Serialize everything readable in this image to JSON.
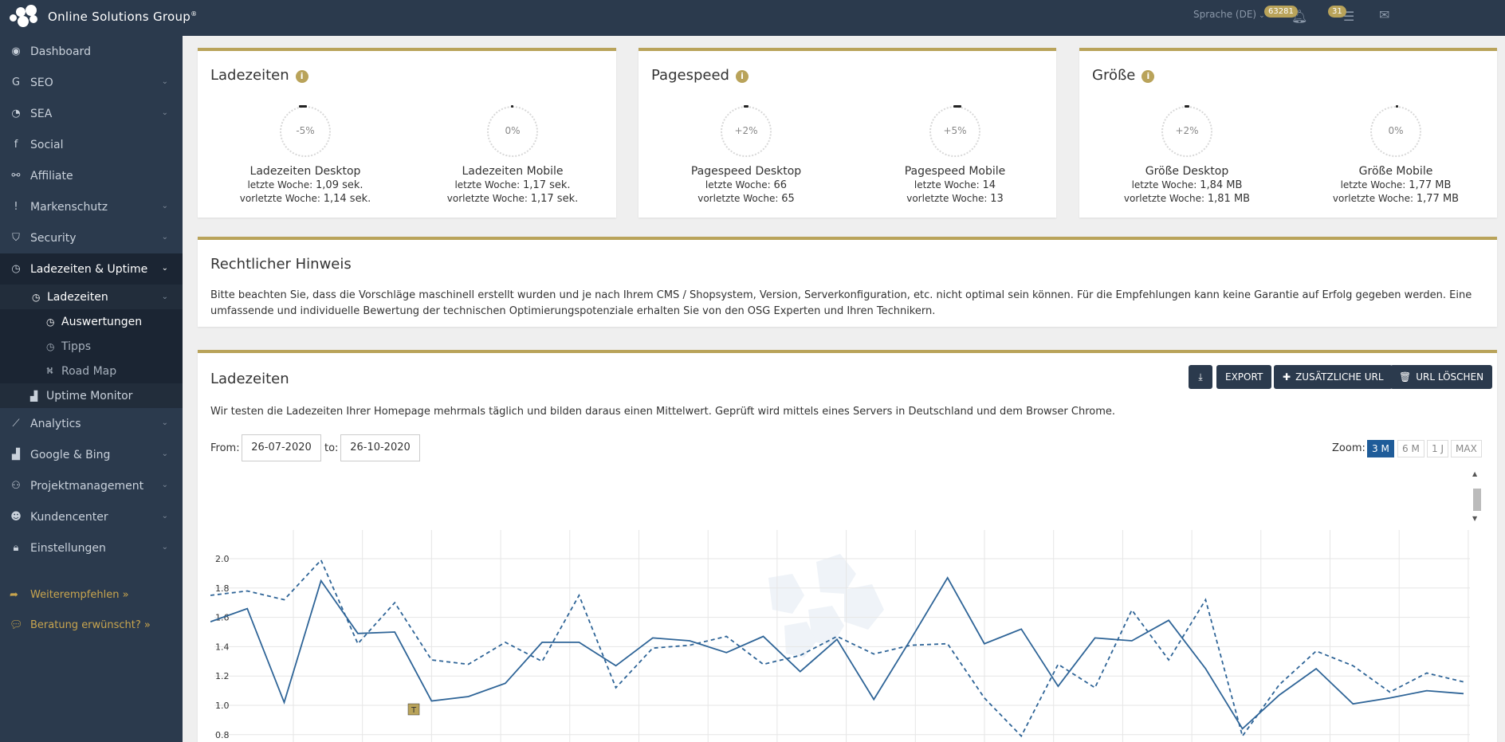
{
  "header": {
    "brand": "Online Solutions Group",
    "brand_mark": "®",
    "language": "Sprache (DE)",
    "notification_count": "63281",
    "message_count": "31"
  },
  "sidebar": {
    "items": [
      {
        "label": "Dashboard",
        "icon": "dashboard-icon"
      },
      {
        "label": "SEO",
        "icon": "google-icon"
      },
      {
        "label": "SEA",
        "icon": "pie-chart-icon"
      },
      {
        "label": "Social",
        "icon": "facebook-icon"
      },
      {
        "label": "Affiliate",
        "icon": "handshake-icon"
      },
      {
        "label": "Markenschutz",
        "icon": "exclamation-icon"
      },
      {
        "label": "Security",
        "icon": "shield-icon"
      },
      {
        "label": "Ladezeiten & Uptime",
        "icon": "clock-icon"
      }
    ],
    "sub": {
      "ladezeiten": "Ladezeiten",
      "auswertungen": "Auswertungen",
      "tipps": "Tipps",
      "road_map": "Road Map",
      "uptime_monitor": "Uptime Monitor"
    },
    "items_after": [
      {
        "label": "Analytics",
        "icon": "line-chart-icon"
      },
      {
        "label": "Google & Bing",
        "icon": "area-chart-icon"
      },
      {
        "label": "Projektmanagement",
        "icon": "sitemap-icon"
      },
      {
        "label": "Kundencenter",
        "icon": "users-icon"
      },
      {
        "label": "Einstellungen",
        "icon": "lock-icon"
      }
    ],
    "weiterempfehlen": "Weiterempfehlen »",
    "beratung": "Beratung erwünscht? »"
  },
  "panels": {
    "ladezeiten": {
      "title": "Ladezeiten",
      "desktop": {
        "value": "-5%",
        "name": "Ladezeiten Desktop",
        "last_label": "letzte Woche:",
        "last": "1,09 sek.",
        "prev_label": "vorletzte Woche:",
        "prev": "1,14 sek."
      },
      "mobile": {
        "value": "0%",
        "name": "Ladezeiten Mobile",
        "last_label": "letzte Woche:",
        "last": "1,17 sek.",
        "prev_label": "vorletzte Woche:",
        "prev": "1,17 sek."
      }
    },
    "pagespeed": {
      "title": "Pagespeed",
      "desktop": {
        "value": "+2%",
        "name": "Pagespeed Desktop",
        "last_label": "letzte Woche:",
        "last": "66",
        "prev_label": "vorletzte Woche:",
        "prev": "65"
      },
      "mobile": {
        "value": "+5%",
        "name": "Pagespeed Mobile",
        "last_label": "letzte Woche:",
        "last": "14",
        "prev_label": "vorletzte Woche:",
        "prev": "13"
      }
    },
    "groesse": {
      "title": "Größe",
      "desktop": {
        "value": "+2%",
        "name": "Größe Desktop",
        "last_label": "letzte Woche:",
        "last": "1,84 MB",
        "prev_label": "vorletzte Woche:",
        "prev": "1,81 MB"
      },
      "mobile": {
        "value": "0%",
        "name": "Größe Mobile",
        "last_label": "letzte Woche:",
        "last": "1,77 MB",
        "prev_label": "vorletzte Woche:",
        "prev": "1,77 MB"
      }
    }
  },
  "notice": {
    "title": "Rechtlicher Hinweis",
    "text": "Bitte beachten Sie, dass die Vorschläge maschinell erstellt wurden und je nach Ihrem CMS / Shopsystem, Version, Serverkonfiguration, etc. nicht optimal sein können. Für die Empfehlungen kann keine Garantie auf Erfolg gegeben werden. Eine umfassende und individuelle Bewertung der technischen Optimierungspotenziale erhalten Sie von den OSG Experten und Ihren Technikern."
  },
  "loadtimes": {
    "title": "Ladezeiten",
    "buttons": {
      "download": "download-icon",
      "export": "EXPORT",
      "add_url": "ZUSÄTZLICHE URL",
      "delete_url": "URL LÖSCHEN"
    },
    "description": "Wir testen die Ladezeiten Ihrer Homepage mehrmals täglich und bilden daraus einen Mittelwert. Geprüft wird mittels eines Servers in Deutschland und dem Browser Chrome.",
    "from_label": "From:",
    "from_value": "26-07-2020",
    "to_label": "to:",
    "to_value": "26-10-2020",
    "zoom_label": "Zoom:",
    "zoom_options": [
      "3 M",
      "6 M",
      "1 J",
      "MAX"
    ],
    "zoom_selected": "3 M",
    "flag_label": "T"
  },
  "chart_data": {
    "type": "line",
    "yticks": [
      "2.0",
      "1.8",
      "1.6",
      "1.4",
      "1.2",
      "1.0",
      "0.8"
    ],
    "ylim": [
      0.8,
      2.0
    ],
    "series": [
      {
        "style": "solid",
        "values": [
          1.57,
          1.66,
          1.02,
          1.85,
          1.49,
          1.5,
          1.03,
          1.06,
          1.15,
          1.43,
          1.43,
          1.27,
          1.46,
          1.44,
          1.36,
          1.47,
          1.23,
          1.45,
          1.04,
          1.45,
          1.87,
          1.42,
          1.52,
          1.13,
          1.46,
          1.44,
          1.58,
          1.25,
          0.84,
          1.07,
          1.25,
          1.01,
          1.05,
          1.1,
          1.08
        ]
      },
      {
        "style": "dashed",
        "values": [
          1.75,
          1.78,
          1.72,
          1.99,
          1.42,
          1.7,
          1.31,
          1.28,
          1.43,
          1.3,
          1.75,
          1.12,
          1.39,
          1.41,
          1.47,
          1.28,
          1.34,
          1.47,
          1.35,
          1.41,
          1.42,
          1.05,
          0.79,
          1.28,
          1.12,
          1.65,
          1.31,
          1.72,
          0.79,
          1.14,
          1.37,
          1.27,
          1.09,
          1.22,
          1.16
        ]
      }
    ]
  }
}
